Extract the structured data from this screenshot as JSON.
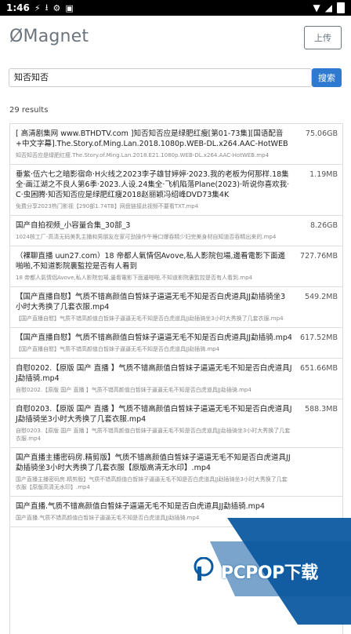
{
  "status": {
    "time": "1:46",
    "icons": [
      "thunder-icon",
      "download-icon",
      "gear-icon",
      "app-icon"
    ]
  },
  "header": {
    "logo": "ØMagnet",
    "upload_label": "上传"
  },
  "search": {
    "value": "知否知否",
    "button_label": "搜索"
  },
  "results": {
    "count_text": "29 results",
    "items": [
      {
        "title": "[ 高清剧集网 www.BTHDTV.com ]知否知否应是绿肥红瘦[第01-73集][国语配音+中文字幕].The.Story.of.Ming.Lan.2018.1080p.WEB-DL.x264.AAC-HotWEB",
        "sub": "知否知否应是绿肥红瘦.The.Story.of.Ming.Lan.2018.E21.1080p.WEB-DL.x264.AAC-HotWEB.mp4",
        "size": "75.06GB"
      },
      {
        "title": "垂紫·伍六七之暗影宿命·H火线之2023李子雄甘婷婷·2023.我的老板为何那样.18集全·画江湖之不良人第6季·2023.人设.24集全·飞机陷落Plane(2023)·听说你喜欢我·C·虫困腾·知否知否应是绿肥红瘦2018赵丽颖冯绍峰DVD73集4K",
        "sub": "免费分享2023热门影视【290部1.74TB】网盘链接此视频不要看TXT.mp4",
        "size": "1.19MB"
      },
      {
        "title": "国产自拍视频_小容量合集_30部_3",
        "sub": "1024核工厂-高清无码美乳主播和男朋友在家可劲操作午睡口爆吞精少妇完美身材自知道否吞精出来的.mp4",
        "size": "8.26GB"
      },
      {
        "title": "（裸聊直播 uun27.com）18 帝都人氣情侶Avove,私人影院包場,邊看電影下面邊啪啪,不知道影院裏監控是否有人看到",
        "sub": "18 帝都人氣情侶Avove,私人影院包場,邊看電影下面邊啪啪,不知道影院裏監控是否有人看到.mp4",
        "size": "727.76MB"
      },
      {
        "title": "【国产直播自慰】气质不错高颜值白皙妹子逼逼无毛不知是否白虎道具JJ勐插骑坐3小时大秀换了几套衣服.mp4",
        "sub": "【国产直播自慰】气质不错高颜值白皙妹子逼逼无毛不知是否白虎道具JJ勐插骑坐3小时大秀换了几套衣服.mp4",
        "size": "549.2MB"
      },
      {
        "title": "【国产直播自慰】气质不错高颜值白皙妹子逼逼无毛不知是否白虎道具JJ勐插骑.mp4",
        "sub": "【国产直播自慰】气质不错高颜值白皙妹子逼逼无毛不知是否白虎道具JJ勐插骑.mp4",
        "size": "617.52MB"
      },
      {
        "title": "自慰0202.【原版 国产 直播 】气质不错高颜值白皙妹子逼逼无毛不知是否白虎道具JJ勐插骑.mp4",
        "sub": "自慰0202.【原版 国产 直播 】气质不错高颜值白皙妹子逼逼无毛不知是否白虎道具JJ勐插骑.mp4",
        "size": "651.66MB"
      },
      {
        "title": "自慰0203.【原版 国产 直播 】气质不错高颜值白皙妹子逼逼无毛不知是否白虎道具JJ勐插骑坐3小时大秀换了几套衣服.mp4",
        "sub": "自慰0203.【原版 国产 直播 】气质不错高颜值白皙妹子逼逼无毛不知是否白虎道具JJ勐插骑坐3小时大秀换了几套衣服.mp4",
        "size": "588.3MB"
      },
      {
        "title": "国产直播主播密码房.精剪版】气质不错高颜值白皙妹子逼逼无毛不知是否白虎道具JJ勐插骑坐3小时大秀换了几套衣服【原版高清无水印】.mp4",
        "sub": "国产直播主播密码房.精剪版】气质不错高颜值白皙妹子逼逼无毛不知是否白虎道具JJ勐插骑坐3小时大秀换了几套衣服【原版高清无水印】.mp4",
        "size": ""
      },
      {
        "title": "国产直播.气质不错高颜值白皙妹子逼逼无毛不知是否白虎道具JJ勐插骑.mp4",
        "sub": "国产直播.气质不错高颜值白皙妹子逼逼无毛不知是否白虎道具JJ勐插骑.mp4",
        "size": ""
      }
    ]
  },
  "watermark": {
    "text": "PCPOP下载",
    "colors": {
      "blue": "#0d5aa0",
      "light": "#ffffff"
    }
  }
}
